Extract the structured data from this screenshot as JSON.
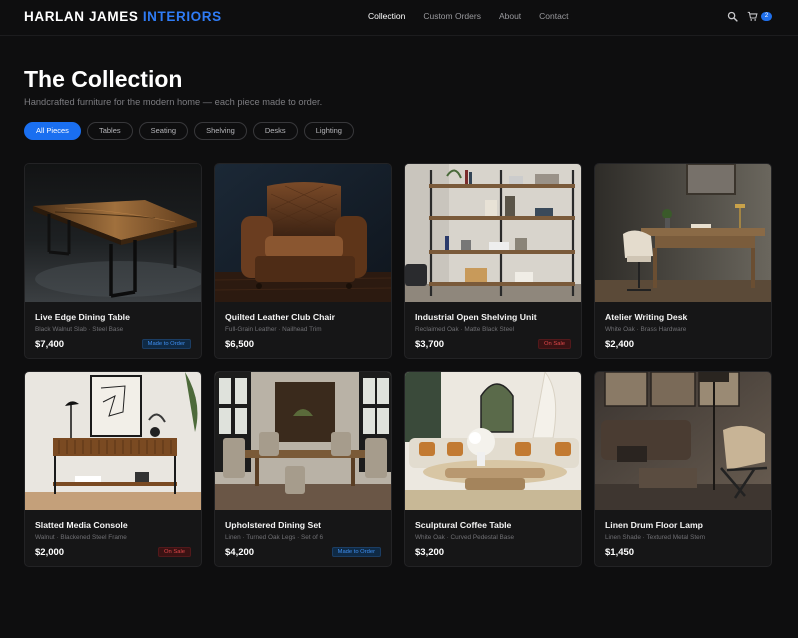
{
  "brand": {
    "name": "HARLAN JAMES",
    "accent": "INTERIORS",
    "accent_color": "#2f7cf6"
  },
  "nav": {
    "links": [
      "Collection",
      "Custom Orders",
      "About",
      "Contact"
    ],
    "active": "Collection",
    "search_icon": "search-icon",
    "cart_icon": "cart-icon",
    "cart_count": "2"
  },
  "hero": {
    "title": "The Collection",
    "subtitle": "Handcrafted furniture for the modern home — each piece made to order."
  },
  "filters": {
    "items": [
      "All Pieces",
      "Tables",
      "Seating",
      "Shelving",
      "Desks",
      "Lighting"
    ],
    "active": "All Pieces"
  },
  "products": [
    {
      "name": "Live Edge Dining Table",
      "materials": "Black Walnut Slab · Steel Base",
      "price": "$7,400",
      "badge": "Made to Order"
    },
    {
      "name": "Quilted Leather Club Chair",
      "materials": "Full-Grain Leather · Nailhead Trim",
      "price": "$6,500",
      "badge": ""
    },
    {
      "name": "Industrial Open Shelving Unit",
      "materials": "Reclaimed Oak · Matte Black Steel",
      "price": "$3,700",
      "badge": "On Sale"
    },
    {
      "name": "Atelier Writing Desk",
      "materials": "White Oak · Brass Hardware",
      "price": "$2,400",
      "badge": ""
    },
    {
      "name": "Slatted Media Console",
      "materials": "Walnut · Blackened Steel Frame",
      "price": "$2,000",
      "badge": "On Sale"
    },
    {
      "name": "Upholstered Dining Set",
      "materials": "Linen · Turned Oak Legs · Set of 6",
      "price": "$4,200",
      "badge": "Made to Order"
    },
    {
      "name": "Sculptural Coffee Table",
      "materials": "White Oak · Curved Pedestal Base",
      "price": "$3,200",
      "badge": ""
    },
    {
      "name": "Linen Drum Floor Lamp",
      "materials": "Linen Shade · Textured Metal Stem",
      "price": "$1,450",
      "badge": ""
    }
  ],
  "colors": {
    "primary": "#1a6ff0",
    "sale": "#e0484a",
    "background": "#0e0e0f"
  }
}
